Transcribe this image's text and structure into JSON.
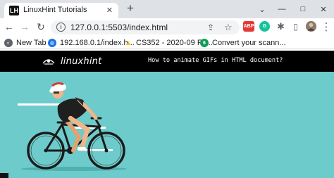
{
  "browser": {
    "tab": {
      "title": "LinuxHint Tutorials",
      "close_glyph": "✕",
      "favicon": "LH"
    },
    "new_tab_glyph": "+",
    "window_controls": {
      "minimize": "⌄",
      "restore": "—",
      "maximize": "□",
      "close": "✕"
    },
    "toolbar": {
      "back_glyph": "←",
      "forward_glyph": "→",
      "reload_glyph": "↻",
      "url": "127.0.0.1:5503/index.html",
      "info_glyph": "i",
      "share_glyph": "⇪",
      "star_glyph": "☆",
      "extensions": [
        {
          "name": "adblock-extension-icon",
          "label": "ABP",
          "color": "#e53935"
        },
        {
          "name": "grammarly-extension-icon",
          "label": "G",
          "color": "#15c39a"
        },
        {
          "name": "puzzle-extension-icon",
          "label": "✱",
          "color": "#5f6368"
        },
        {
          "name": "sidepanel-icon",
          "label": "▯",
          "color": "#5f6368"
        }
      ],
      "menu_glyph": "⋮"
    },
    "bookmarks": [
      {
        "label": "New Tab",
        "icon": "globe-icon",
        "icon_color": "#5f6368",
        "icon_text": "◐"
      },
      {
        "label": "192.168.0.1/index.h...",
        "icon": "router-icon",
        "icon_color": "#1a73e8",
        "icon_text": "◍"
      },
      {
        "label": "CS352 - 2020-09 Fa...",
        "icon": "drive-icon",
        "icon_color": "#fbbc04",
        "icon_text": "▲"
      },
      {
        "label": "Convert your scann...",
        "icon": "convert-icon",
        "icon_color": "#0f9d58",
        "icon_text": "6"
      }
    ]
  },
  "page": {
    "logo_text": "linuxhint",
    "heading": "How to animate GIFs in HTML document?",
    "colors": {
      "header_bg": "#000000",
      "stage_bg": "#6ecbcb"
    }
  }
}
